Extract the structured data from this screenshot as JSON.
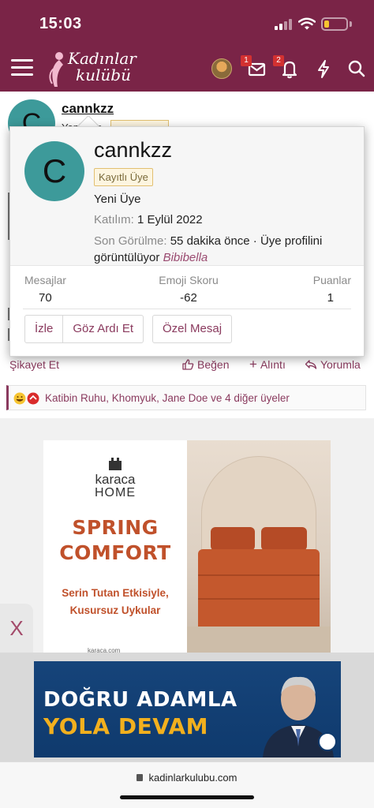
{
  "status_bar": {
    "time": "15:03",
    "battery_level": 0.22,
    "battery_color": "#f6c431"
  },
  "nav": {
    "logo_line1": "Kadınlar",
    "logo_line2": "kulübü",
    "messages_badge": "1",
    "alerts_badge": "2",
    "bar_color": "#7a2447"
  },
  "post": {
    "avatar_letter": "C",
    "username": "cannkzz",
    "role": "Yeni Üye",
    "report_label": "Şikayet Et",
    "like_label": "Beğen",
    "quote_label": "Alıntı",
    "reply_label": "Yorumla",
    "reactions_text": "Katibin Ruhu, Khomyuk, Jane Doe ve 4 diğer üyeler"
  },
  "profile_popup": {
    "avatar_letter": "C",
    "username": "cannkzz",
    "badge": "Kayıtlı Üye",
    "title": "Yeni Üye",
    "joined_label": "Katılım:",
    "joined_value": "1 Eylül 2022",
    "last_seen_label": "Son Görülme:",
    "last_seen_value": "55 dakika önce · Üye profilini görüntülüyor",
    "last_seen_link": "Bibibella",
    "stats": [
      {
        "label": "Mesajlar",
        "value": "70"
      },
      {
        "label": "Emoji Skoru",
        "value": "-62"
      },
      {
        "label": "Puanlar",
        "value": "1"
      }
    ],
    "buttons": {
      "follow": "İzle",
      "ignore": "Göz Ardı Et",
      "message": "Özel Mesaj"
    }
  },
  "ad1": {
    "brand": "karaca",
    "brand_sub": "HOME",
    "headline_line1": "SPRING",
    "headline_line2": "COMFORT",
    "sub_line1": "Serin Tutan Etkisiyle,",
    "sub_line2": "Kusursuz Uykular",
    "url": "karaca.com"
  },
  "ad_close": {
    "label": "X"
  },
  "ad2": {
    "line1": "DOĞRU ADAMLA",
    "line2": "YOLA DEVAM"
  },
  "browser": {
    "url": "kadinlarkulubu.com"
  },
  "colors": {
    "accent": "#8a3a5e",
    "avatar": "#3d9a9a",
    "badge_bg": "#fdf5e0",
    "badge_border": "#e2c071"
  }
}
